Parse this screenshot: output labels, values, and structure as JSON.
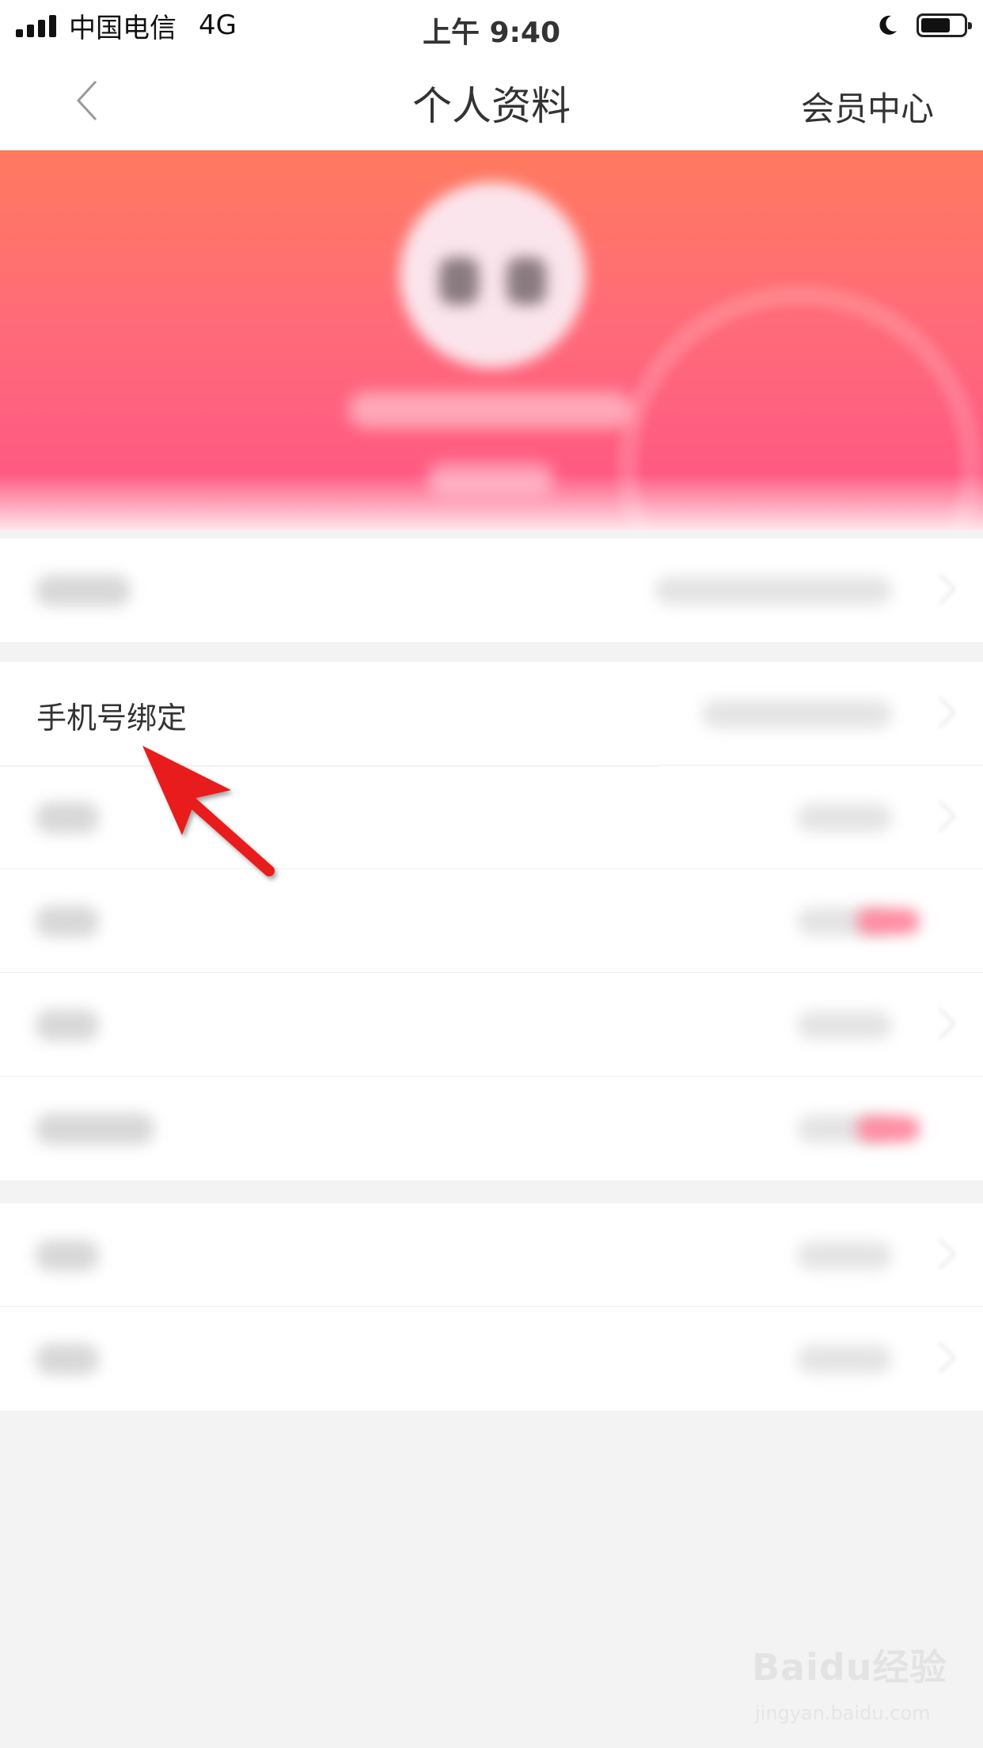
{
  "status_bar": {
    "carrier": "中国电信",
    "network": "4G",
    "time": "上午 9:40",
    "icons": [
      "signal-bars-icon",
      "moon-icon",
      "battery-icon"
    ],
    "battery_level": 0.7
  },
  "nav": {
    "back_icon": "chevron-left-icon",
    "title": "个人资料",
    "right_link": "会员中心"
  },
  "profile": {
    "header_colors": [
      "#ff7a5e",
      "#ff5a82"
    ]
  },
  "rows": {
    "phone_binding_label": "手机号绑定"
  },
  "watermark": {
    "brand": "Baidu经验",
    "url": "jingyan.baidu.com"
  },
  "colors": {
    "accent": "#ff5a82",
    "arrow": "#e81a1a"
  }
}
